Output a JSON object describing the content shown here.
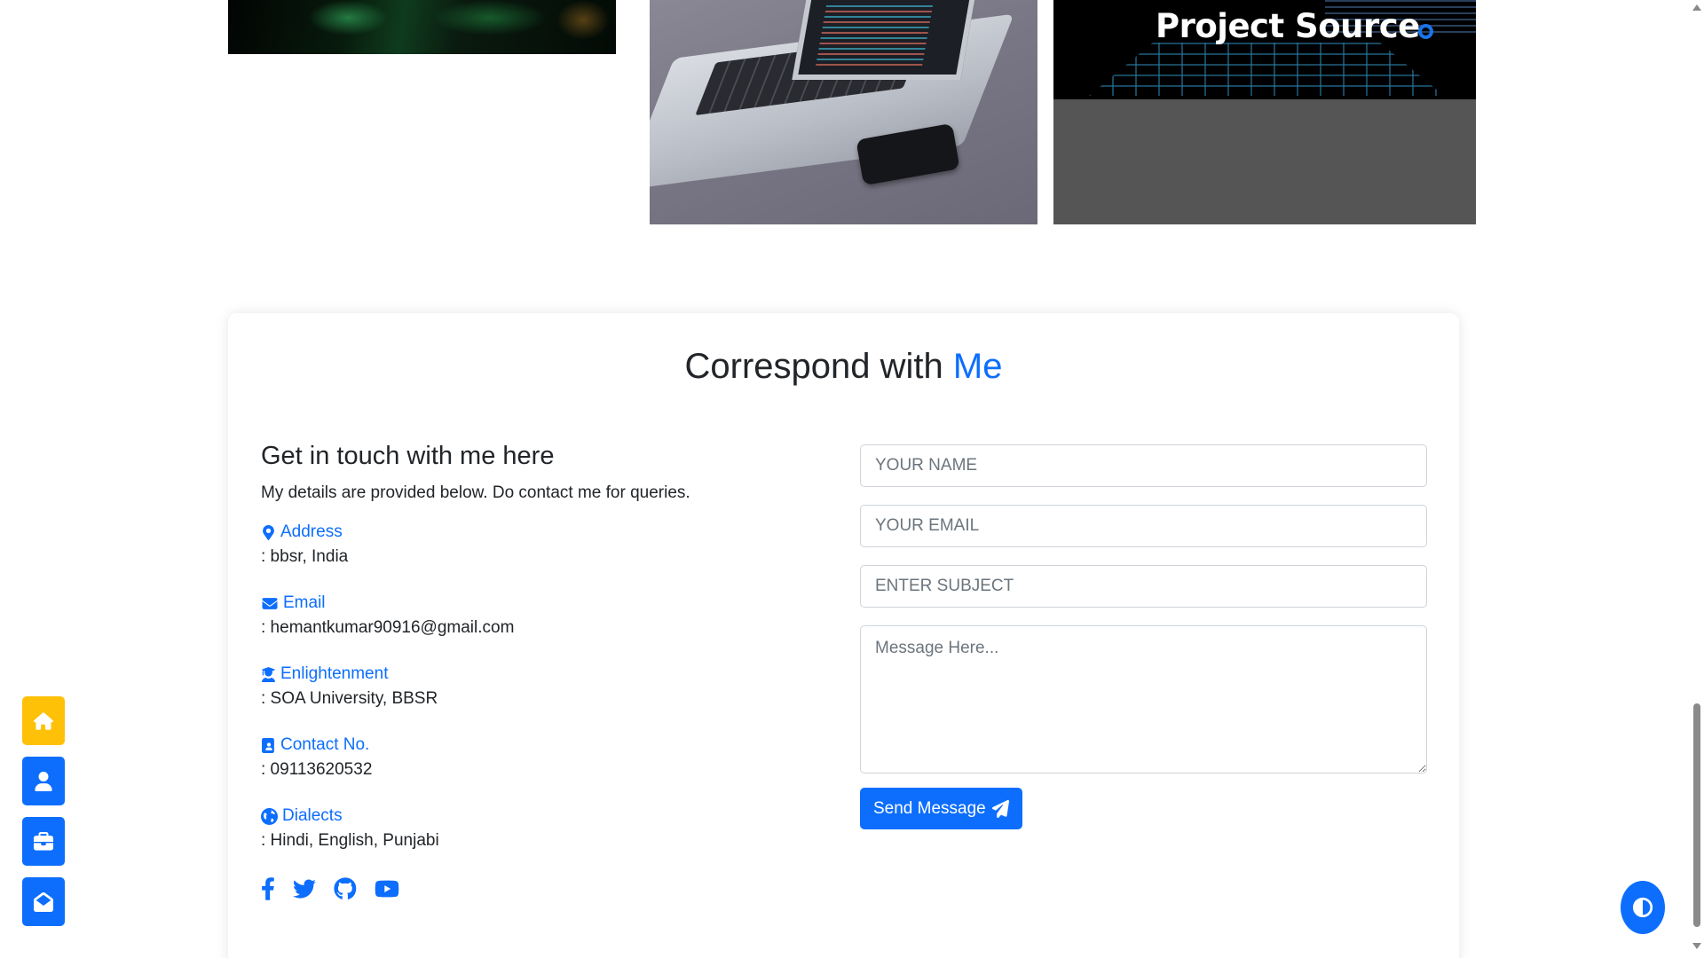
{
  "projects": {
    "card3_title": "Project Source"
  },
  "contact": {
    "title_main": "Correspond with ",
    "title_accent": "Me",
    "heading": "Get in touch with me here",
    "intro": "My details are provided below. Do contact me for queries.",
    "items": [
      {
        "label": "Address",
        "value": ": bbsr, India",
        "icon": "map-marker-icon"
      },
      {
        "label": "Email",
        "value": ": hemantkumar90916@gmail.com",
        "icon": "envelope-icon"
      },
      {
        "label": "Enlightenment",
        "value": ": SOA University, BBSR",
        "icon": "graduate-icon"
      },
      {
        "label": "Contact No.",
        "value": ": 09113620532",
        "icon": "address-book-icon"
      },
      {
        "label": "Dialects",
        "value": ": Hindi, English, Punjabi",
        "icon": "globe-icon"
      }
    ],
    "socials": [
      "facebook-icon",
      "twitter-icon",
      "github-icon",
      "youtube-icon"
    ]
  },
  "form": {
    "name_placeholder": "YOUR NAME",
    "email_placeholder": "YOUR EMAIL",
    "subject_placeholder": "ENTER SUBJECT",
    "message_placeholder": "Message Here...",
    "send_label": "Send Message"
  },
  "side_nav": [
    "home-icon",
    "user-icon",
    "briefcase-icon",
    "envelope-open-icon"
  ],
  "colors": {
    "accent": "#0d6efd",
    "home_button": "#ffc107",
    "text": "#212529"
  }
}
